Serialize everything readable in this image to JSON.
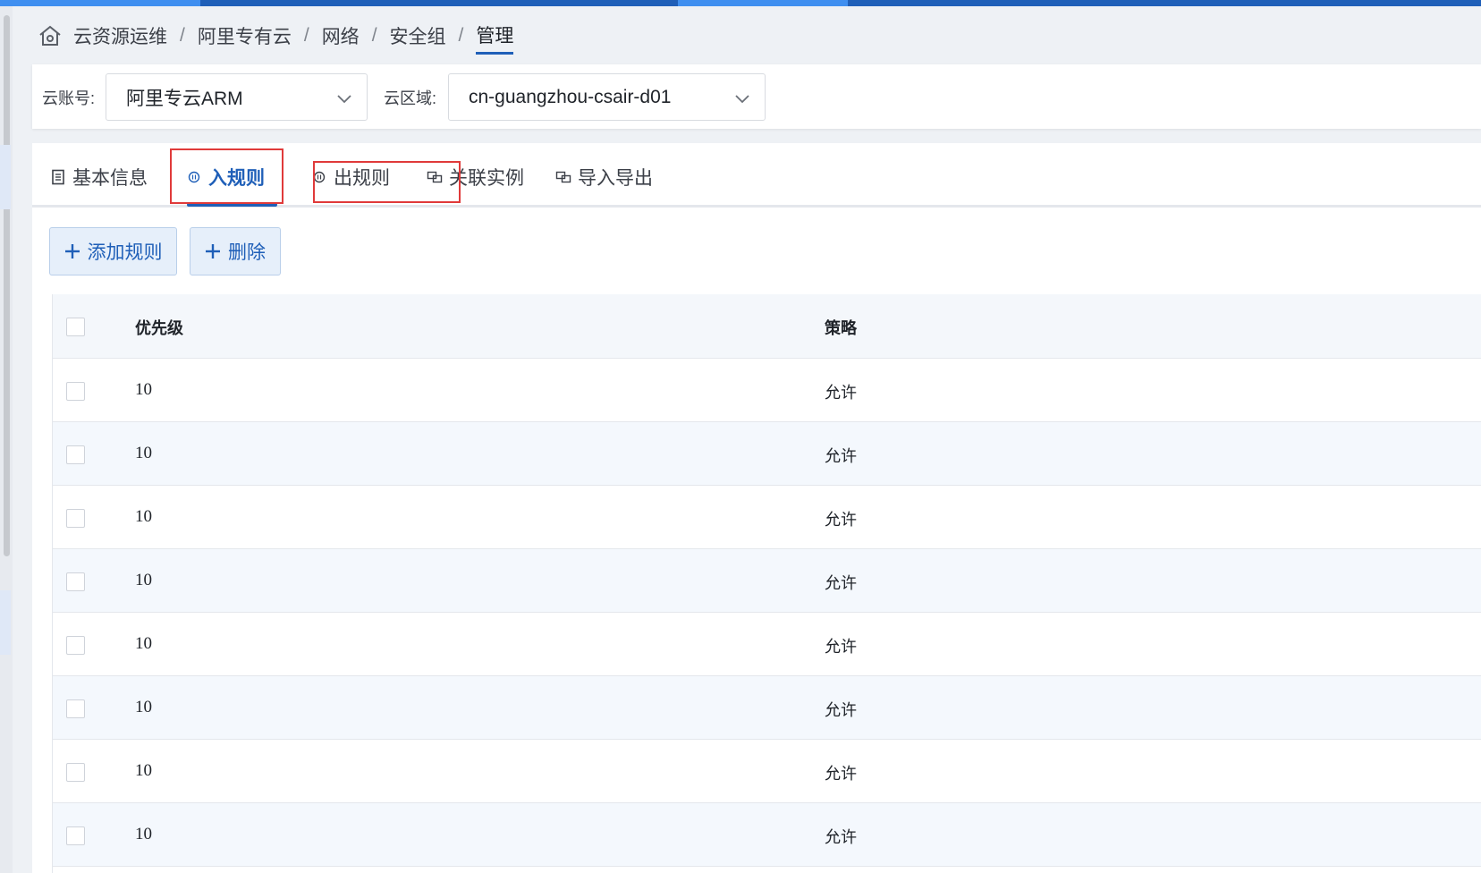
{
  "breadcrumb": {
    "items": [
      "云资源运维",
      "阿里专有云",
      "网络",
      "安全组"
    ],
    "current": "管理",
    "separator": "/"
  },
  "filters": {
    "account_label": "云账号:",
    "account_value": "阿里专云ARM",
    "region_label": "云区域:",
    "region_value": "cn-guangzhou-csair-d01"
  },
  "tabs": [
    {
      "label": "基本信息",
      "icon": "document-icon"
    },
    {
      "label": "入规则",
      "icon": "inbound-icon",
      "active": true
    },
    {
      "label": "出规则",
      "icon": "outbound-icon"
    },
    {
      "label": "关联实例",
      "icon": "link-instance-icon"
    },
    {
      "label": "导入导出",
      "icon": "import-export-icon"
    }
  ],
  "actions": {
    "add_rule": "添加规则",
    "delete": "删除"
  },
  "table": {
    "columns": [
      "优先级",
      "策略"
    ],
    "rows": [
      {
        "priority": "10",
        "policy": "允许"
      },
      {
        "priority": "10",
        "policy": "允许"
      },
      {
        "priority": "10",
        "policy": "允许"
      },
      {
        "priority": "10",
        "policy": "允许"
      },
      {
        "priority": "10",
        "policy": "允许"
      },
      {
        "priority": "10",
        "policy": "允许"
      },
      {
        "priority": "10",
        "policy": "允许"
      },
      {
        "priority": "10",
        "policy": "允许"
      }
    ]
  },
  "colors": {
    "accent": "#1f5fb8",
    "highlight_box": "#e03a3a"
  }
}
